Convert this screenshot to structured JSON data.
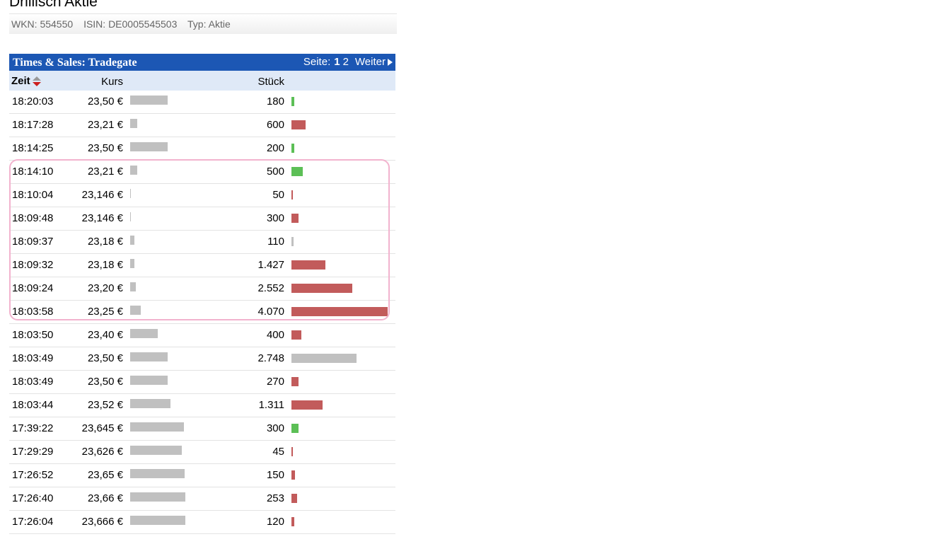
{
  "page_title": "Drillisch Aktie",
  "meta": {
    "wkn": "WKN: 554550",
    "isin": "ISIN: DE0005545503",
    "typ": "Typ: Aktie"
  },
  "times_sales": {
    "title": "Times & Sales: Tradegate",
    "pager": {
      "label": "Seite:",
      "current": "1",
      "other": "2",
      "next": "Weiter"
    }
  },
  "columns": {
    "zeit": "Zeit",
    "kurs": "Kurs",
    "stueck": "Stück"
  },
  "colors": {
    "up": "#5cbf56",
    "down": "#c25b5b",
    "neutral": "#c0c0c0",
    "header_bg": "#1c57b4",
    "subheader_bg": "#dfe9f7",
    "highlight_border": "#f2b3ce"
  },
  "trades": [
    {
      "zeit": "18:20:03",
      "kurs": "23,50 €",
      "kurs_level": 0.38,
      "stueck": "180",
      "stueck_level": 0.03,
      "dir": "up"
    },
    {
      "zeit": "18:17:28",
      "kurs": "23,21 €",
      "kurs_level": 0.07,
      "stueck": "600",
      "stueck_level": 0.15,
      "dir": "down"
    },
    {
      "zeit": "18:14:25",
      "kurs": "23,50 €",
      "kurs_level": 0.38,
      "stueck": "200",
      "stueck_level": 0.03,
      "dir": "up"
    },
    {
      "zeit": "18:14:10",
      "kurs": "23,21 €",
      "kurs_level": 0.07,
      "stueck": "500",
      "stueck_level": 0.12,
      "dir": "up"
    },
    {
      "zeit": "18:10:04",
      "kurs": "23,146 €",
      "kurs_level": 0.01,
      "stueck": "50",
      "stueck_level": 0.01,
      "dir": "down"
    },
    {
      "zeit": "18:09:48",
      "kurs": "23,146 €",
      "kurs_level": 0.01,
      "stueck": "300",
      "stueck_level": 0.07,
      "dir": "down"
    },
    {
      "zeit": "18:09:37",
      "kurs": "23,18 €",
      "kurs_level": 0.04,
      "stueck": "110",
      "stueck_level": 0.02,
      "dir": "neutral"
    },
    {
      "zeit": "18:09:32",
      "kurs": "23,18 €",
      "kurs_level": 0.04,
      "stueck": "1.427",
      "stueck_level": 0.35,
      "dir": "down"
    },
    {
      "zeit": "18:09:24",
      "kurs": "23,20 €",
      "kurs_level": 0.06,
      "stueck": "2.552",
      "stueck_level": 0.63,
      "dir": "down"
    },
    {
      "zeit": "18:03:58",
      "kurs": "23,25 €",
      "kurs_level": 0.11,
      "stueck": "4.070",
      "stueck_level": 1.0,
      "dir": "down"
    },
    {
      "zeit": "18:03:50",
      "kurs": "23,40 €",
      "kurs_level": 0.28,
      "stueck": "400",
      "stueck_level": 0.1,
      "dir": "down"
    },
    {
      "zeit": "18:03:49",
      "kurs": "23,50 €",
      "kurs_level": 0.38,
      "stueck": "2.748",
      "stueck_level": 0.68,
      "dir": "neutral"
    },
    {
      "zeit": "18:03:49",
      "kurs": "23,50 €",
      "kurs_level": 0.38,
      "stueck": "270",
      "stueck_level": 0.07,
      "dir": "down"
    },
    {
      "zeit": "18:03:44",
      "kurs": "23,52 €",
      "kurs_level": 0.41,
      "stueck": "1.311",
      "stueck_level": 0.32,
      "dir": "down"
    },
    {
      "zeit": "17:39:22",
      "kurs": "23,645 €",
      "kurs_level": 0.54,
      "stueck": "300",
      "stueck_level": 0.07,
      "dir": "up"
    },
    {
      "zeit": "17:29:29",
      "kurs": "23,626 €",
      "kurs_level": 0.52,
      "stueck": "45",
      "stueck_level": 0.01,
      "dir": "down"
    },
    {
      "zeit": "17:26:52",
      "kurs": "23,65 €",
      "kurs_level": 0.55,
      "stueck": "150",
      "stueck_level": 0.04,
      "dir": "down"
    },
    {
      "zeit": "17:26:40",
      "kurs": "23,66 €",
      "kurs_level": 0.56,
      "stueck": "253",
      "stueck_level": 0.06,
      "dir": "down"
    },
    {
      "zeit": "17:26:04",
      "kurs": "23,666 €",
      "kurs_level": 0.56,
      "stueck": "120",
      "stueck_level": 0.03,
      "dir": "down"
    }
  ]
}
